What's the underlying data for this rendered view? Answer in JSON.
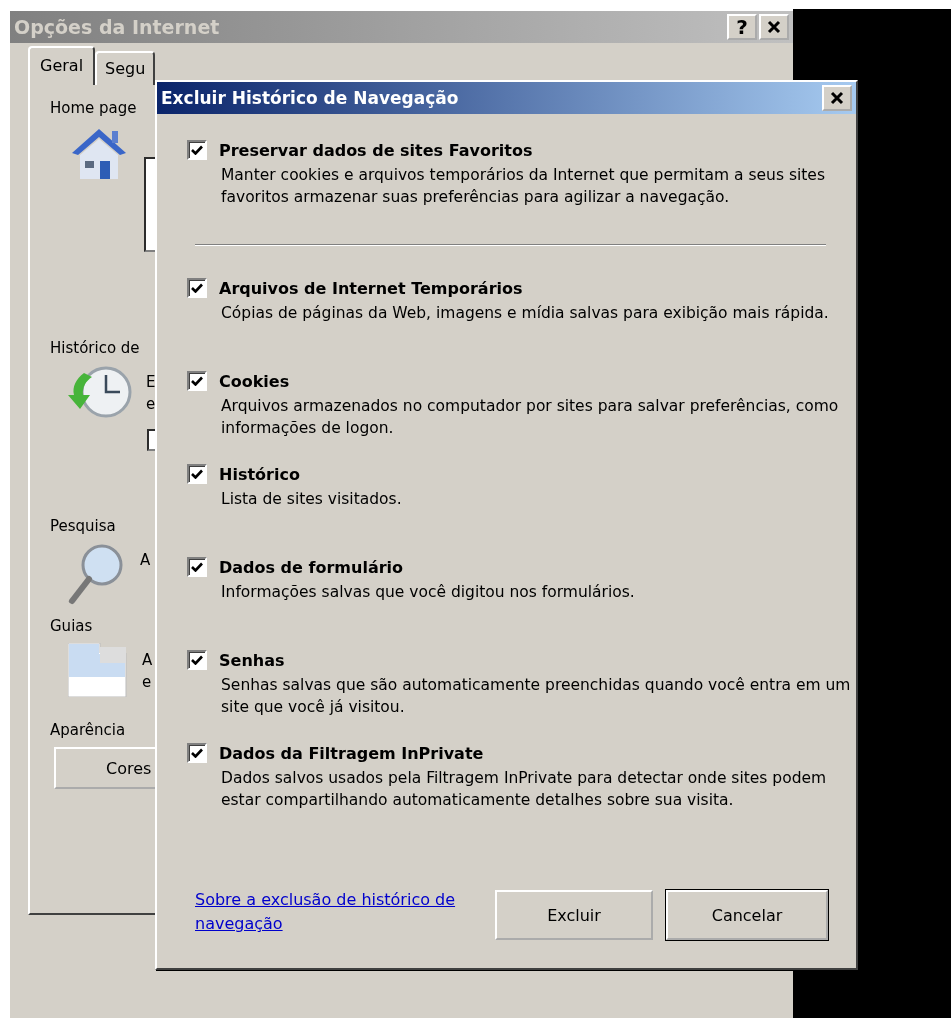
{
  "window": {
    "title": "Opções da Internet",
    "help_label": "?"
  },
  "tabs": [
    {
      "label": "Geral",
      "selected": true
    },
    {
      "label": "Segu",
      "selected": false
    }
  ],
  "sections": [
    {
      "kind": "homepage",
      "heading": "Home page"
    },
    {
      "kind": "history",
      "heading": "Histórico de",
      "lines": [
        "E",
        "e"
      ],
      "checked": false
    },
    {
      "kind": "search",
      "heading": "Pesquisa",
      "lines": [
        "A"
      ]
    },
    {
      "kind": "tabs",
      "heading": "Guias",
      "lines": [
        "A",
        "e"
      ]
    },
    {
      "kind": "appearance",
      "heading": "Aparência",
      "button": "Cores"
    }
  ],
  "dialog": {
    "title": "Excluir Histórico de Navegação",
    "options": [
      {
        "title": "Preservar dados de sites Favoritos",
        "description": "Manter cookies e arquivos temporários da Internet que permitam a seus sites favoritos armazenar suas preferências para agilizar a navegação.",
        "checked": true
      },
      {
        "title": "Arquivos de Internet Temporários",
        "description": "Cópias de páginas da Web, imagens e mídia salvas para exibição mais rápida.",
        "checked": true
      },
      {
        "title": "Cookies",
        "description": "Arquivos armazenados no computador por sites para salvar preferências, como informações de logon.",
        "checked": true
      },
      {
        "title": "Histórico",
        "description": "Lista de sites visitados.",
        "checked": true
      },
      {
        "title": "Dados de formulário",
        "description": "Informações salvas que você digitou nos formulários.",
        "checked": true
      },
      {
        "title": "Senhas",
        "description": "Senhas salvas que são automaticamente preenchidas quando você entra em um site que você já visitou.",
        "checked": true
      },
      {
        "title": "Dados da Filtragem InPrivate",
        "description": "Dados salvos usados pela Filtragem InPrivate para detectar onde sites podem estar compartilhando automaticamente detalhes sobre sua visita.",
        "checked": true
      }
    ],
    "link": "Sobre a exclusão de histórico de navegação",
    "buttons": [
      {
        "label": "Excluir",
        "default": false
      },
      {
        "label": "Cancelar",
        "default": true
      }
    ]
  }
}
